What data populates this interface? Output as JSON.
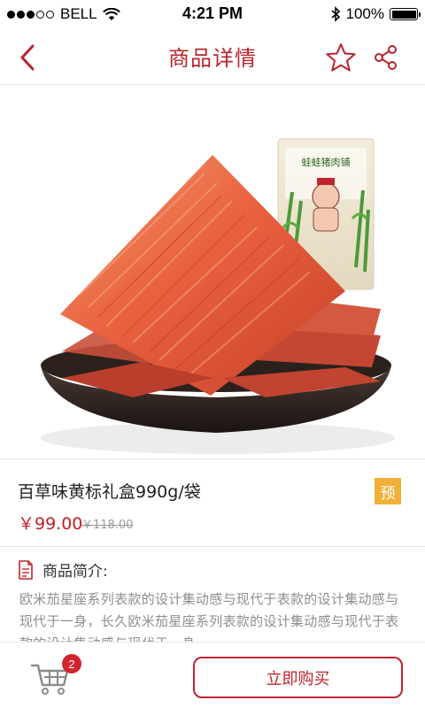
{
  "status_bar": {
    "carrier": "BELL",
    "time": "4:21 PM",
    "battery": "100%",
    "battery_level": 1.0
  },
  "nav": {
    "title": "商品详情",
    "back_icon": "chevron-left-icon",
    "favorite_icon": "star-outline-icon",
    "share_icon": "share-icon"
  },
  "product": {
    "name": "百草味黄标礼盒990g/袋",
    "badge": "预",
    "price": "￥99.00",
    "original_price": "￥118.00",
    "package_label": "蛙蛙猪肉铺"
  },
  "intro": {
    "label": "商品简介:",
    "text": "欧米茄星座系列表款的设计集动感与现代于表款的设计集动感与现代于一身，长久欧米茄星座系列表款的设计集动感与现代于表款的设计集动感与现代于一身。"
  },
  "bottom": {
    "cart_count": "2",
    "buy_label": "立即购买"
  },
  "colors": {
    "accent": "#b8242c",
    "badge": "#f0b03a",
    "price": "#c21f2a"
  }
}
